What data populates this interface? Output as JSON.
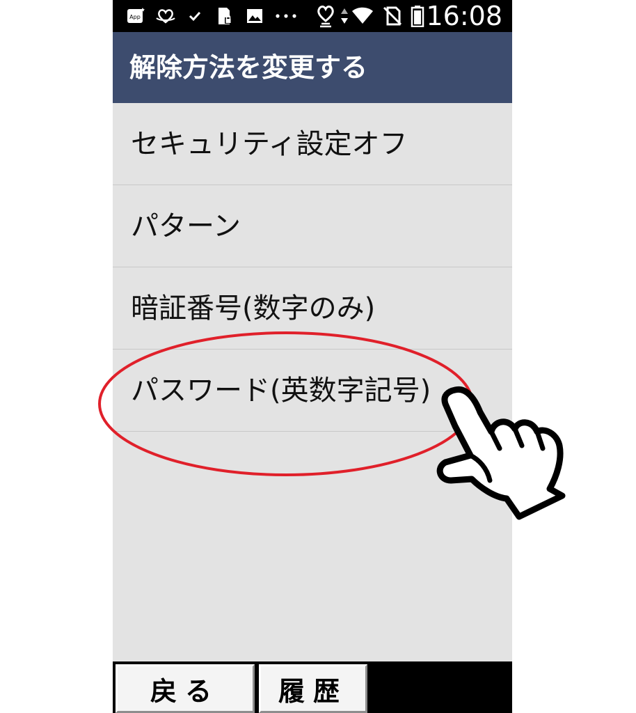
{
  "status_bar": {
    "time": "16:08",
    "app_badge": "App",
    "icons": [
      "app-icon",
      "heart-sync-icon",
      "check-icon",
      "sd-card-icon",
      "image-icon",
      "more-dots-icon",
      "heart-icon",
      "data-arrows-icon",
      "wifi-icon",
      "no-sim-icon",
      "battery-icon"
    ]
  },
  "title_bar": {
    "title": "解除方法を変更する"
  },
  "menu": {
    "items": [
      {
        "label": "セキュリティ設定オフ"
      },
      {
        "label": "パターン"
      },
      {
        "label": "暗証番号(数字のみ)"
      },
      {
        "label": "パスワード(英数字記号)"
      }
    ]
  },
  "softkeys": {
    "back": "戻る",
    "history": "履歴"
  },
  "annotation": {
    "highlight_color": "#e0202a",
    "pointer": "hand-pointer-icon"
  }
}
